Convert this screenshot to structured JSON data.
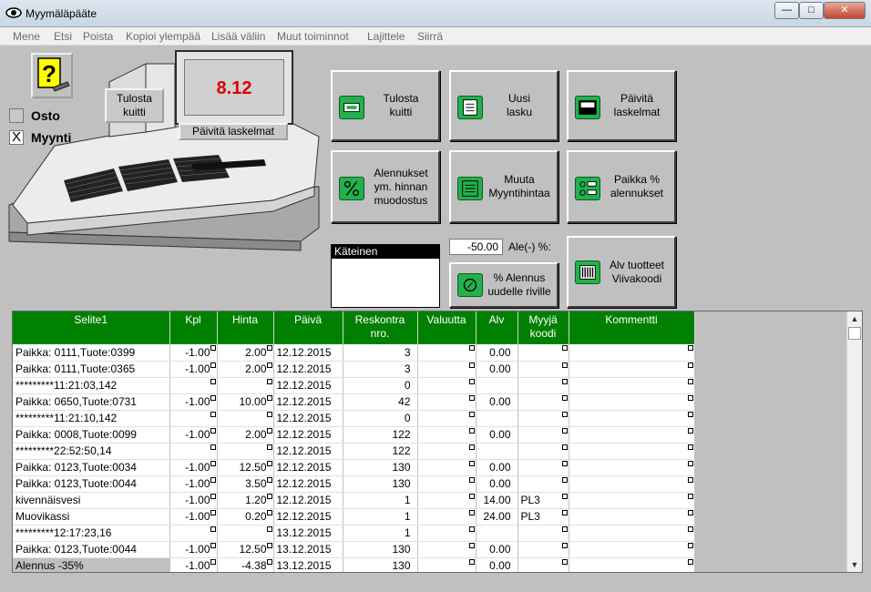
{
  "window": {
    "title": "Myymäläpääte"
  },
  "menu": [
    "Mene",
    "Etsi",
    "Poista",
    "Kopioi ylempää",
    "Lisää väliin",
    "Muut toiminnot",
    "Lajittele",
    "Siirrä"
  ],
  "register": {
    "help_icon": "question-mark-icon",
    "print_receipt": "Tulosta\nkuitti",
    "display_value": "8.12",
    "update_calc": "Päivitä laskelmat",
    "osto": {
      "label": "Osto",
      "checked": false
    },
    "myynti": {
      "label": "Myynti",
      "checked": true,
      "mark": "X"
    }
  },
  "actions": [
    {
      "label": "Tulosta\nkuitti",
      "icon": "printer-icon"
    },
    {
      "label": "Uusi\nlasku",
      "icon": "new-invoice-icon"
    },
    {
      "label": "Päivitä\nlaskelmat",
      "icon": "calculator-icon"
    },
    {
      "label": "Alennukset\nym. hinnan\nmuodostus",
      "icon": "percent-icon"
    },
    {
      "label": "Muuta\nMyyntihintaa",
      "icon": "price-list-icon"
    },
    {
      "label": "Paikka %\nalennukset",
      "icon": "location-discount-icon"
    },
    {
      "label": "% Alennus\nuudelle riville",
      "icon": "discount-row-icon"
    },
    {
      "label": "Alv tuotteet\nViivakoodi",
      "icon": "barcode-icon"
    }
  ],
  "payment": {
    "selected": "Käteinen"
  },
  "discount": {
    "value": "-50.00",
    "label": "Ale(-) %:"
  },
  "grid": {
    "columns": [
      "Selite1",
      "Kpl",
      "Hinta",
      "Päivä",
      "Reskontra\nnro.",
      "Valuutta",
      "Alv",
      "Myyjä\nkoodi",
      "Kommentti"
    ],
    "rows": [
      [
        "Paikka: 0111,Tuote:0399",
        "-1.00",
        "2.00",
        "12.12.2015",
        "3",
        "",
        "0.00",
        "",
        ""
      ],
      [
        "Paikka: 0111,Tuote:0365",
        "-1.00",
        "2.00",
        "12.12.2015",
        "3",
        "",
        "0.00",
        "",
        ""
      ],
      [
        "*********11:21:03,142",
        "",
        "",
        "12.12.2015",
        "0",
        "",
        "",
        "",
        ""
      ],
      [
        "Paikka: 0650,Tuote:0731",
        "-1.00",
        "10.00",
        "12.12.2015",
        "42",
        "",
        "0.00",
        "",
        ""
      ],
      [
        "*********11:21:10,142",
        "",
        "",
        "12.12.2015",
        "0",
        "",
        "",
        "",
        ""
      ],
      [
        "Paikka: 0008,Tuote:0099",
        "-1.00",
        "2.00",
        "12.12.2015",
        "122",
        "",
        "0.00",
        "",
        ""
      ],
      [
        "*********22:52:50,14",
        "",
        "",
        "12.12.2015",
        "122",
        "",
        "",
        "",
        ""
      ],
      [
        "Paikka: 0123,Tuote:0034",
        "-1.00",
        "12.50",
        "12.12.2015",
        "130",
        "",
        "0.00",
        "",
        ""
      ],
      [
        "Paikka: 0123,Tuote:0044",
        "-1.00",
        "3.50",
        "12.12.2015",
        "130",
        "",
        "0.00",
        "",
        ""
      ],
      [
        "kivennäisvesi",
        "-1.00",
        "1.20",
        "12.12.2015",
        "1",
        "",
        "14.00",
        "PL3",
        ""
      ],
      [
        "Muovikassi",
        "-1.00",
        "0.20",
        "12.12.2015",
        "1",
        "",
        "24.00",
        "PL3",
        ""
      ],
      [
        "*********12:17:23,16",
        "",
        "",
        "13.12.2015",
        "1",
        "",
        "",
        "",
        ""
      ],
      [
        "Paikka: 0123,Tuote:0044",
        "-1.00",
        "12.50",
        "13.12.2015",
        "130",
        "",
        "0.00",
        "",
        ""
      ],
      [
        "Alennus -35%",
        "-1.00",
        "-4.38",
        "13.12.2015",
        "130",
        "",
        "0.00",
        "",
        ""
      ]
    ]
  },
  "colors": {
    "grid_header": "#008000",
    "display_text": "#e00000",
    "icon_green": "#22b14c"
  }
}
